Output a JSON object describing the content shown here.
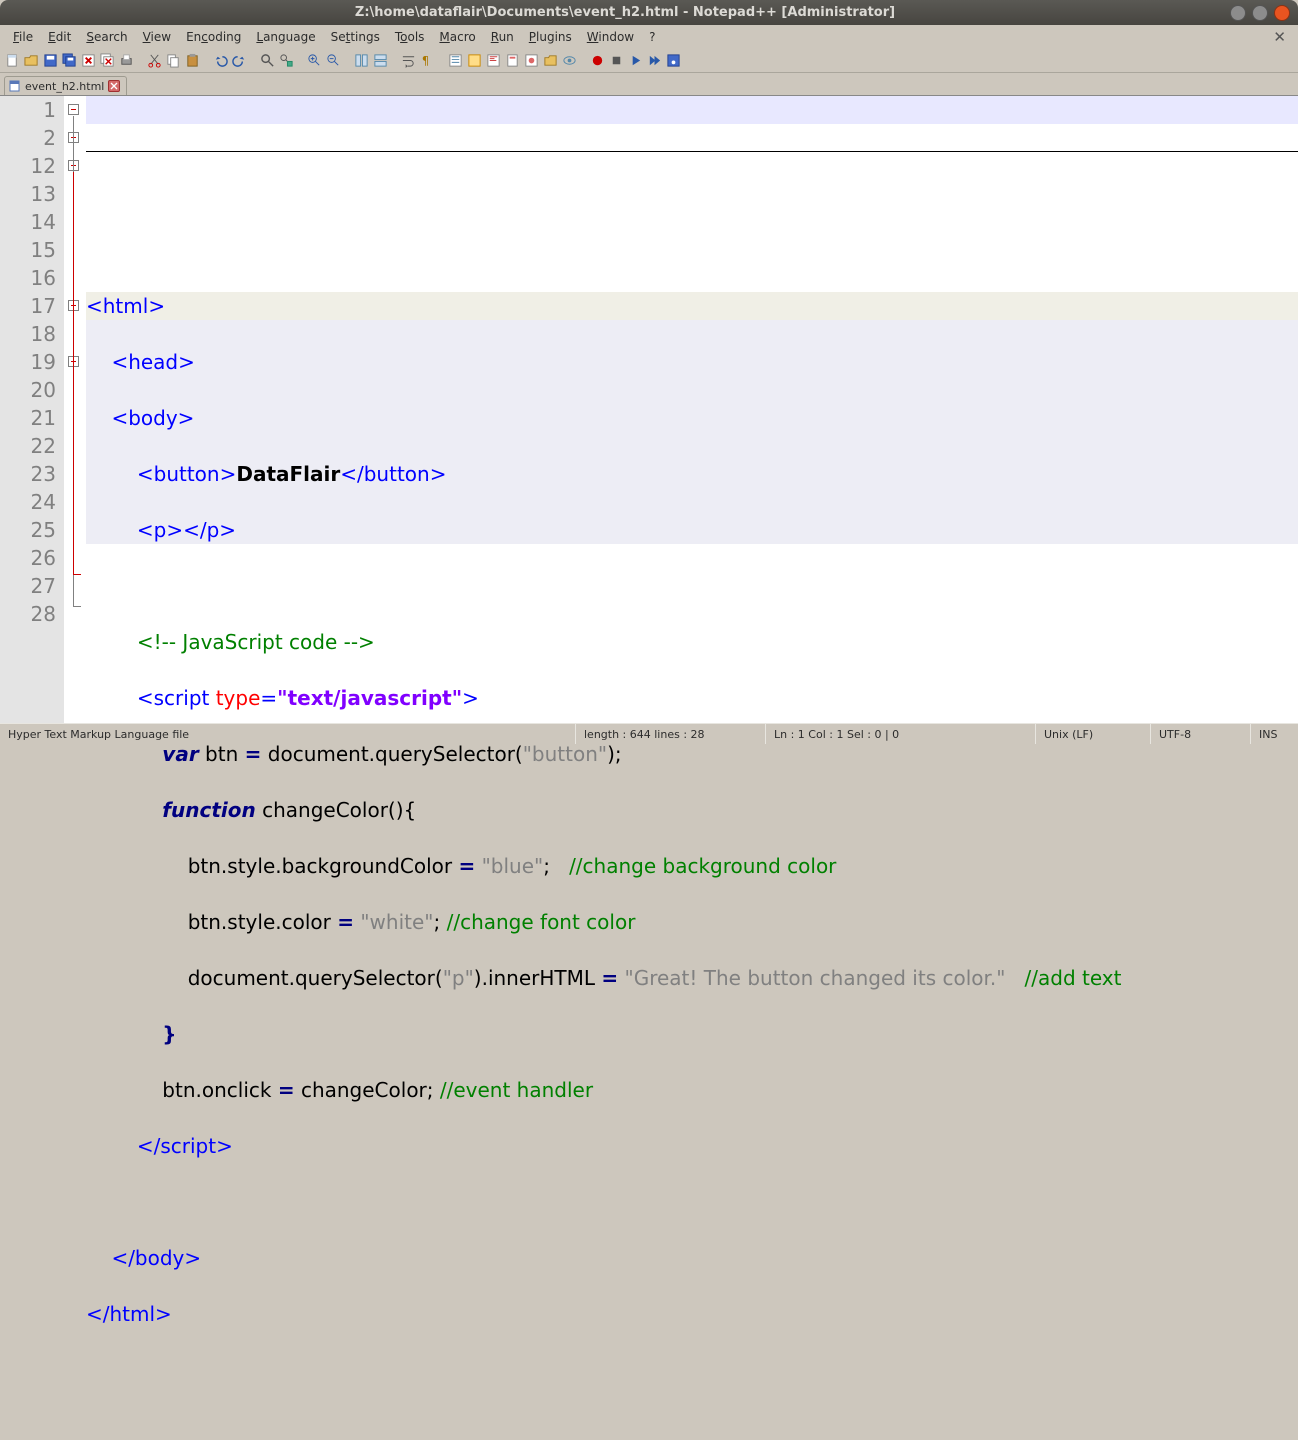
{
  "title": "Z:\\home\\dataflair\\Documents\\event_h2.html - Notepad++ [Administrator]",
  "menu": {
    "file": "File",
    "edit": "Edit",
    "search": "Search",
    "view": "View",
    "encoding": "Encoding",
    "language": "Language",
    "settings": "Settings",
    "tools": "Tools",
    "macro": "Macro",
    "run": "Run",
    "plugins": "Plugins",
    "window": "Window",
    "help": "?"
  },
  "tab": {
    "name": "event_h2.html"
  },
  "gutter": [
    "1",
    "2",
    "12",
    "13",
    "14",
    "15",
    "16",
    "17",
    "18",
    "19",
    "20",
    "21",
    "22",
    "23",
    "24",
    "25",
    "26",
    "27",
    "28"
  ],
  "code": {
    "l1": {
      "t1": "<html>"
    },
    "l2": {
      "t1": "<head>"
    },
    "l3": {
      "t1": "<body>"
    },
    "l4": {
      "t1": "<button>",
      "txt": "DataFlair",
      "t2": "</button>"
    },
    "l5": {
      "t1": "<p></p>"
    },
    "l7": {
      "c": "<!-- JavaScript code -->"
    },
    "l8": {
      "t1": "<script ",
      "a": "type",
      "eq": "=",
      "s": "\"text/javascript\"",
      "t2": ">"
    },
    "l9": {
      "k": "var",
      "r": " btn ",
      "op": "=",
      "r2": " document.querySelector(",
      "s": "\"button\"",
      "r3": ");"
    },
    "l10": {
      "k": "function",
      "r": " changeColor(){"
    },
    "l11": {
      "r": "btn.style.backgroundColor ",
      "op": "=",
      "s": " \"blue\"",
      "r2": ";   ",
      "c": "//change background color"
    },
    "l12": {
      "r": "btn.style.color ",
      "op": "=",
      "s": " \"white\"",
      "r2": "; ",
      "c": "//change font color"
    },
    "l13": {
      "r": "document.querySelector(",
      "s": "\"p\"",
      "r2": ").innerHTML ",
      "op": "=",
      "s2": " \"Great! The button changed its color.\"",
      "r3": "   ",
      "c": "//add text"
    },
    "l14": {
      "r": "}"
    },
    "l15": {
      "r": "btn.onclick ",
      "op": "=",
      "r2": " changeColor; ",
      "c": "//event handler"
    },
    "l16": {
      "t1": "</script>"
    },
    "l18": {
      "t1": "</body>"
    },
    "l19": {
      "t1": "</html>"
    }
  },
  "status": {
    "type": "Hyper Text Markup Language file",
    "len": "length : 644    lines : 28",
    "pos": "Ln : 1    Col : 1    Sel : 0 | 0",
    "eol": "Unix (LF)",
    "enc": "UTF-8",
    "ins": "INS"
  }
}
